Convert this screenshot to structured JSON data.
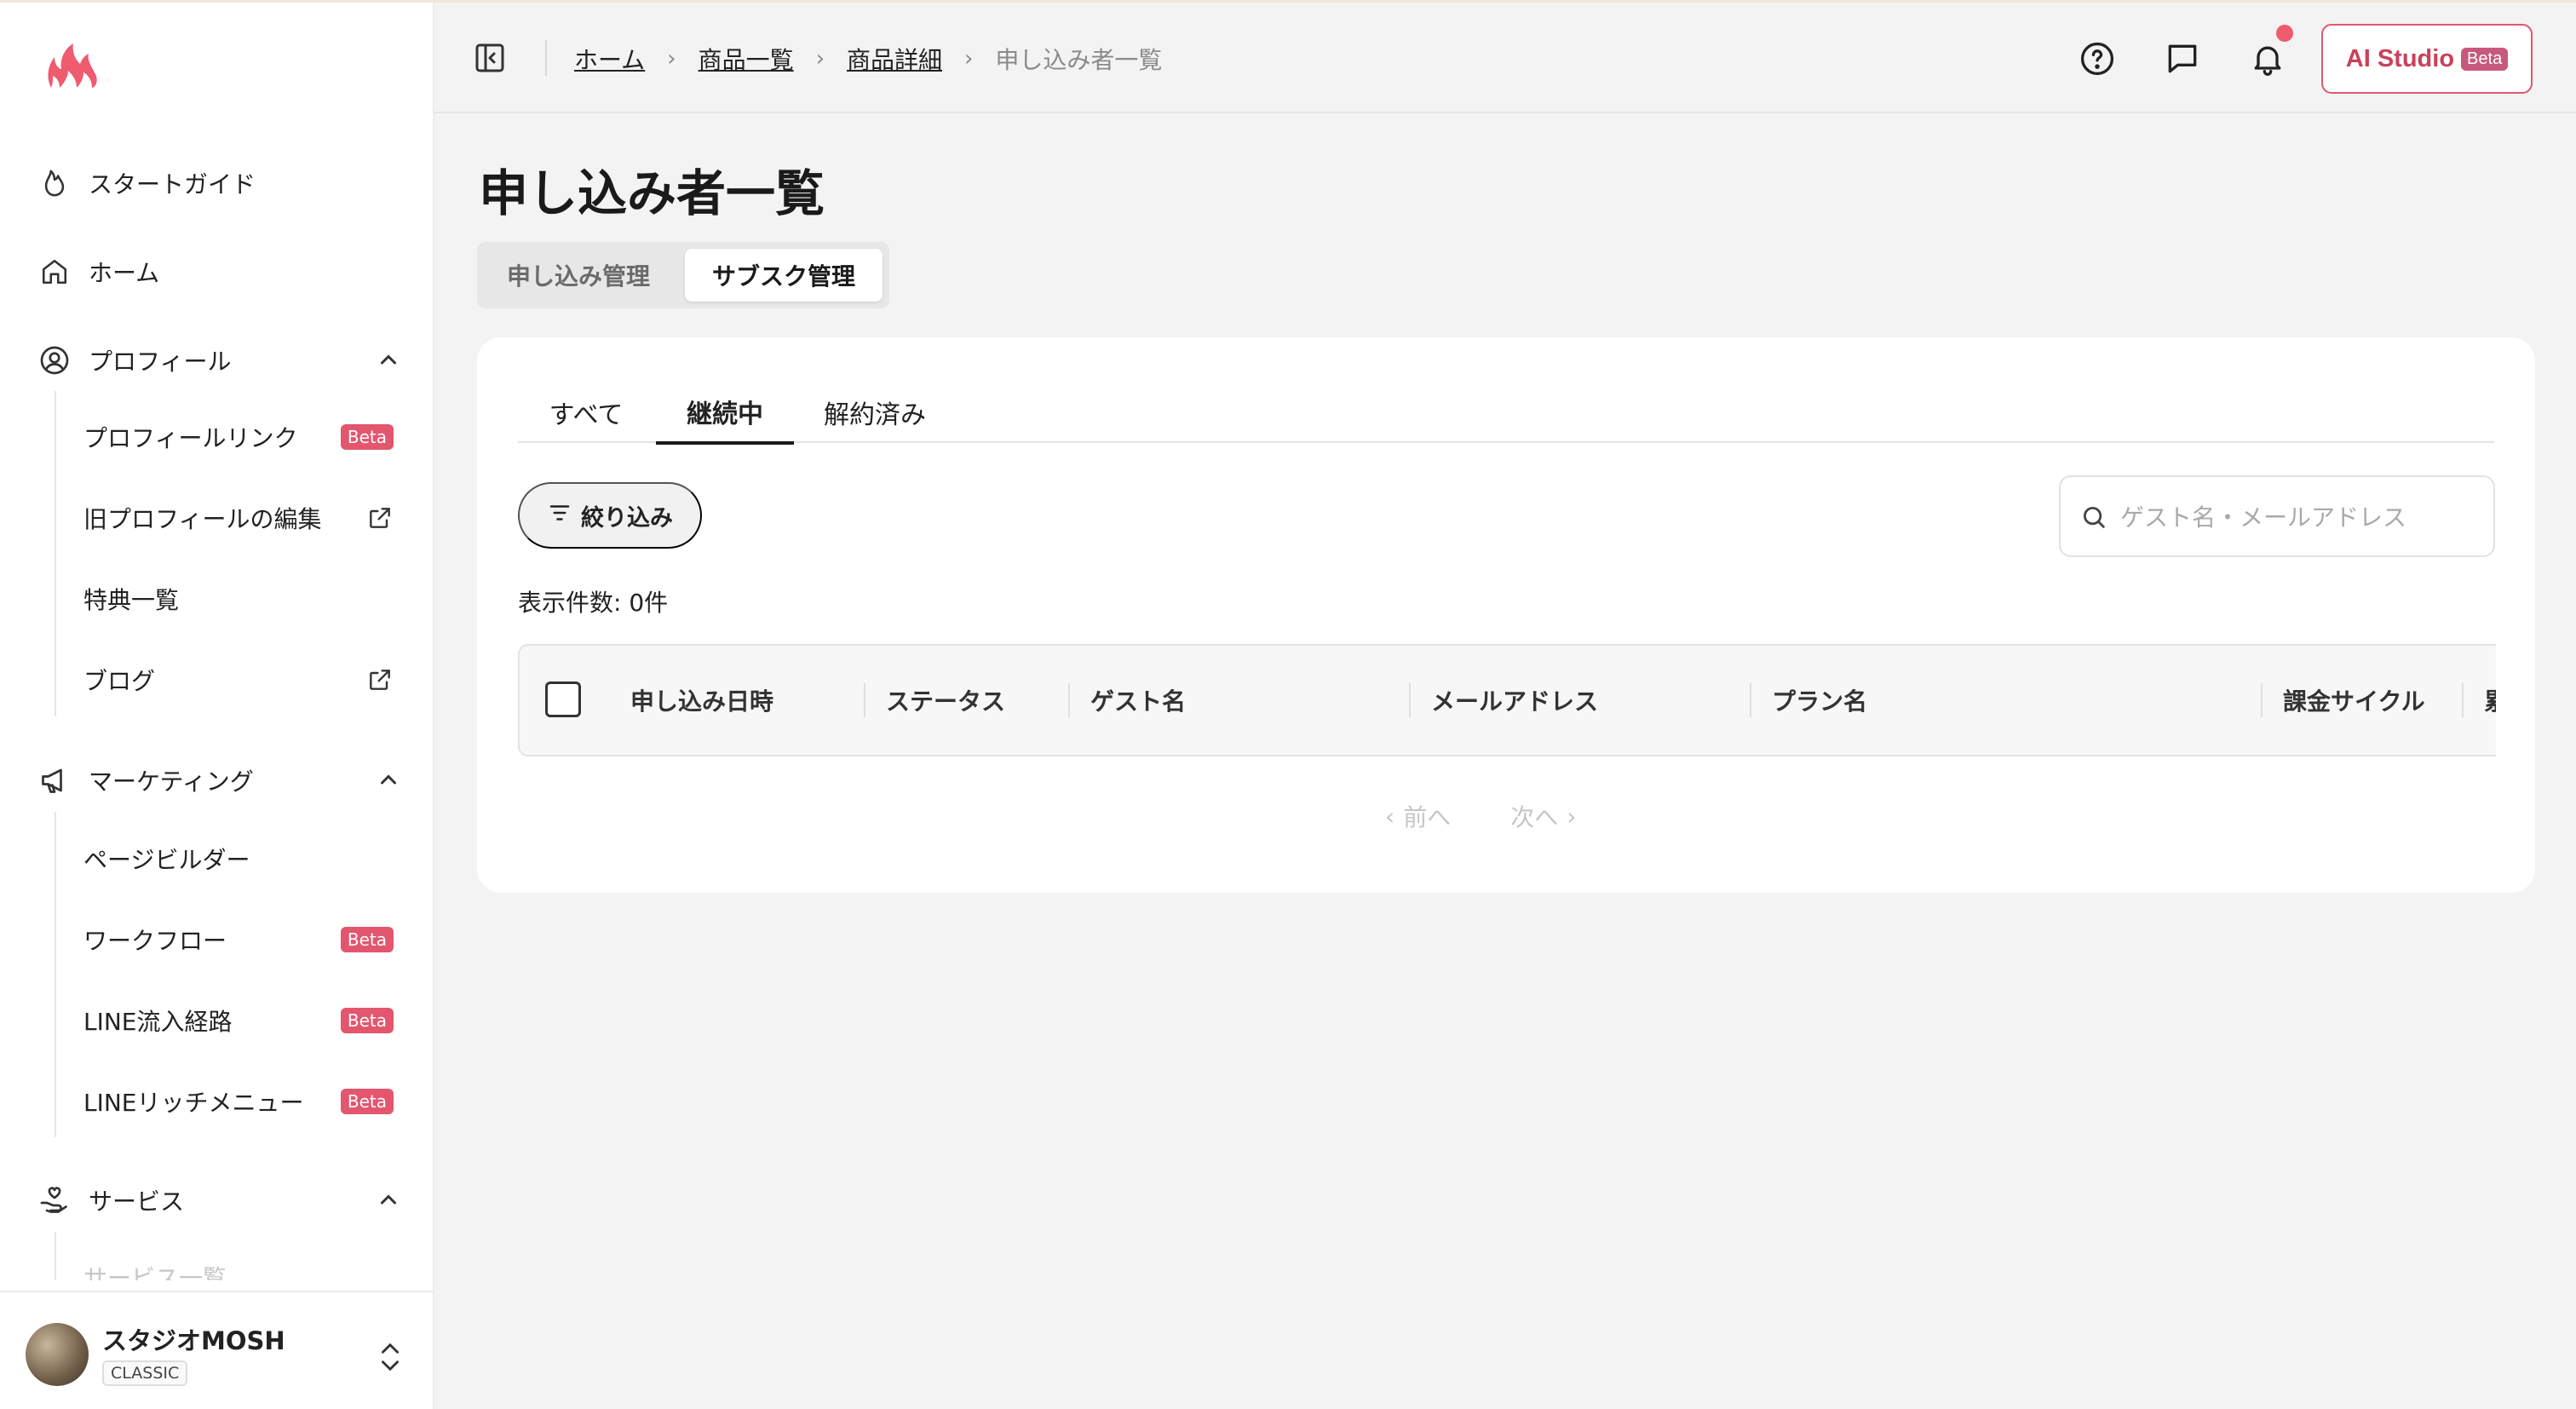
{
  "sidebar": {
    "items": [
      {
        "label": "スタートガイド"
      },
      {
        "label": "ホーム"
      },
      {
        "label": "プロフィール"
      },
      {
        "label": "マーケティング"
      },
      {
        "label": "サービス"
      }
    ],
    "profile_sub": [
      {
        "label": "プロフィールリンク",
        "badge": "Beta"
      },
      {
        "label": "旧プロフィールの編集"
      },
      {
        "label": "特典一覧"
      },
      {
        "label": "ブログ"
      }
    ],
    "marketing_sub": [
      {
        "label": "ページビルダー"
      },
      {
        "label": "ワークフロー",
        "badge": "Beta"
      },
      {
        "label": "LINE流入経路",
        "badge": "Beta"
      },
      {
        "label": "LINEリッチメニュー",
        "badge": "Beta"
      }
    ],
    "service_sub": [
      {
        "label": "サービス一覧"
      }
    ],
    "account": {
      "name": "スタジオMOSH",
      "plan": "CLASSIC"
    }
  },
  "header": {
    "breadcrumb": [
      "ホーム",
      "商品一覧",
      "商品詳細",
      "申し込み者一覧"
    ],
    "ai_studio": {
      "label": "AI Studio",
      "badge": "Beta"
    }
  },
  "main": {
    "title": "申し込み者一覧",
    "segments": [
      "申し込み管理",
      "サブスク管理"
    ],
    "tabs": [
      "すべて",
      "継続中",
      "解約済み"
    ],
    "filter_label": "絞り込み",
    "search_placeholder": "ゲスト名・メールアドレス",
    "count_label": "表示件数: 0件",
    "columns": [
      "申し込み日時",
      "ステータス",
      "ゲスト名",
      "メールアドレス",
      "プラン名",
      "課金サイクル",
      "累"
    ],
    "pager": {
      "prev": "前へ",
      "next": "次へ"
    }
  },
  "colors": {
    "accent": "#e3566e",
    "background": "#f4f3f3",
    "card": "#ffffff"
  }
}
